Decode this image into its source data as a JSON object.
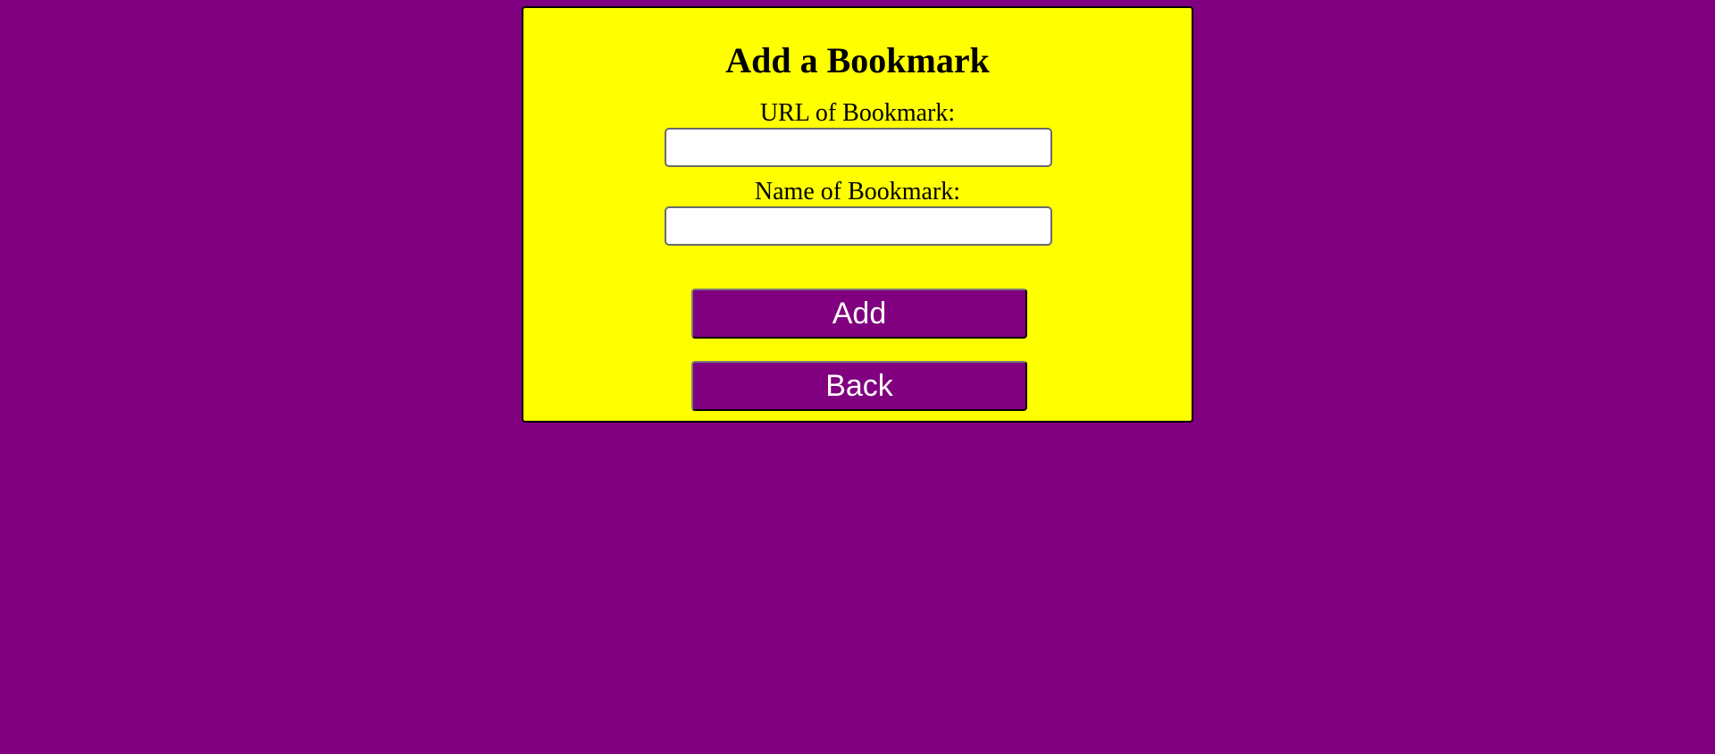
{
  "page": {
    "background_color": "#800080",
    "card_color": "#ffff00"
  },
  "form": {
    "title": "Add a Bookmark",
    "url_label": "URL of Bookmark:",
    "url_value": "",
    "name_label": "Name of Bookmark:",
    "name_value": ""
  },
  "buttons": {
    "add_label": "Add",
    "back_label": "Back",
    "color": "#800080",
    "text_color": "#ffffff"
  }
}
